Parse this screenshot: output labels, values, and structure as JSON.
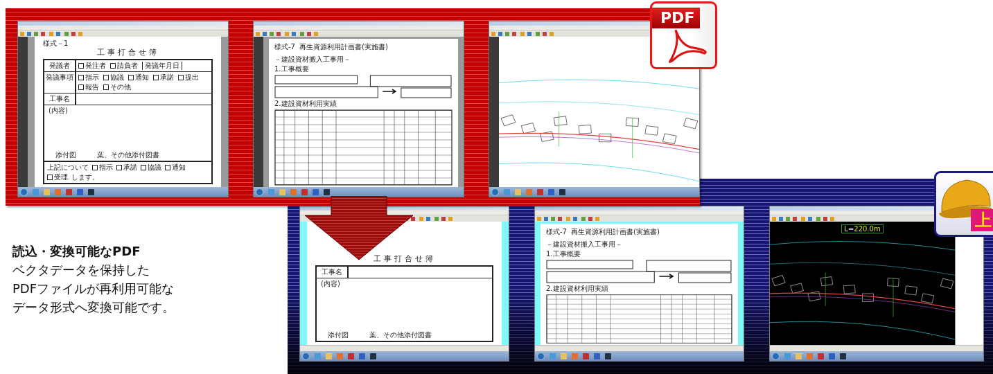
{
  "caption": {
    "title": "読込・変換可能なPDF",
    "lines": [
      "ベクタデータを保持した",
      "PDFファイルが再利用可能な",
      "データ形式へ変換可能です。"
    ]
  },
  "pdf_badge": {
    "label": "PDF"
  },
  "converted_badge": {
    "label": "上"
  },
  "source_screens": [
    {
      "kind": "form",
      "form_no": "様式－1",
      "title": "工事打合せ簿",
      "rows": [
        {
          "label": "発議者",
          "options": [
            "発注者",
            "請負者"
          ],
          "extra": "発議年月日"
        },
        {
          "label": "発議事項",
          "options": [
            "指示",
            "協議",
            "通知",
            "承諾",
            "提出",
            "報告",
            "その他"
          ]
        },
        {
          "label": "工事名",
          "options": []
        }
      ],
      "body_label": "(内容)",
      "attachment": "添付図",
      "attachment_note": "葉、その他添付図書",
      "footer_lead": "上記について",
      "footer_options": [
        "指示",
        "承諾",
        "協議",
        "通知",
        "受理"
      ],
      "footer_tail": "します。"
    },
    {
      "kind": "table",
      "form_no": "様式-7",
      "title": "再生資源利用計画書(実施書)",
      "subtitle": "－建設資材搬入工事用－",
      "sections": [
        "1.工事概要",
        "2.建設資材利用実績"
      ]
    },
    {
      "kind": "map"
    }
  ],
  "converted_screens": [
    {
      "kind": "form",
      "title": "工事打合せ簿",
      "rows": [
        {
          "label": "工事名",
          "options": []
        }
      ],
      "body_label": "(内容)",
      "attachment": "添付図",
      "attachment_note": "葉、その他添付図書"
    },
    {
      "kind": "table",
      "form_no": "様式-7",
      "title": "再生資源利用計画書(実施書)",
      "subtitle": "－建設資材搬入工事用－",
      "sections": [
        "1.工事概要",
        "2.建設資材利用実績"
      ]
    },
    {
      "kind": "cad",
      "length_label": "L=220.0m"
    }
  ]
}
